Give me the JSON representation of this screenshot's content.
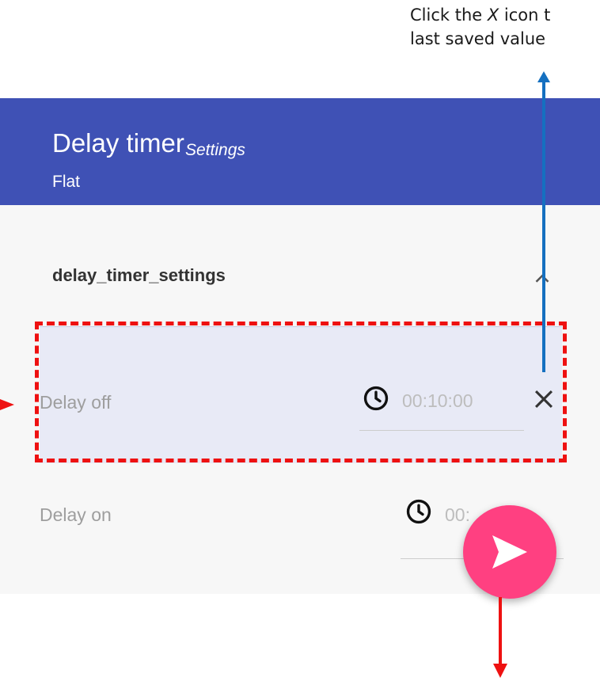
{
  "annotation": {
    "callout_lines": [
      "Click the ",
      "X",
      " icon t",
      "last saved value"
    ],
    "accent_colors": {
      "arrow_blue": "#1570c0",
      "highlight_red": "#ee1111"
    }
  },
  "header": {
    "title": "Delay timer",
    "subtitle": "Settings",
    "detail": "Flat",
    "background_color": "#3f51b5"
  },
  "section": {
    "title": "delay_timer_settings",
    "toggle_icon": "chevron-up-icon"
  },
  "fields": {
    "delay_off": {
      "label": "Delay off",
      "value": "00:10:00",
      "icon": "clock-icon",
      "clear_icon": "close-icon"
    },
    "delay_on": {
      "label": "Delay on",
      "value": "00:",
      "icon": "clock-icon"
    }
  },
  "fab": {
    "icon": "send-icon",
    "color": "#ff4081"
  }
}
